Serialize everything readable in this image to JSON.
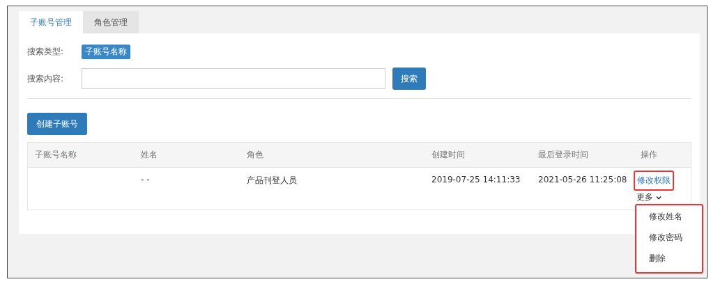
{
  "tabs": [
    {
      "label": "子账号管理",
      "selected": true
    },
    {
      "label": "角色管理",
      "selected": false
    }
  ],
  "search": {
    "type_label": "搜索类型:",
    "type_tag": "子账号名称",
    "content_label": "搜索内容:",
    "button": "搜索"
  },
  "create_button": "创建子账号",
  "table": {
    "columns": [
      "子账号名称",
      "姓名",
      "角色",
      "创建时间",
      "最后登录时间",
      "操作"
    ],
    "rows": [
      {
        "cells": [
          "",
          "- -",
          "产品刊登人员",
          "2019-07-25 14:11:33",
          "2021-05-26 11:25:08"
        ],
        "action": {
          "label": "修改权限",
          "highlighted": true
        },
        "more": {
          "label": "更多",
          "expanded": true
        }
      }
    ]
  },
  "more_menu": {
    "highlighted": true,
    "items": [
      "修改姓名",
      "修改密码",
      "删除"
    ]
  }
}
